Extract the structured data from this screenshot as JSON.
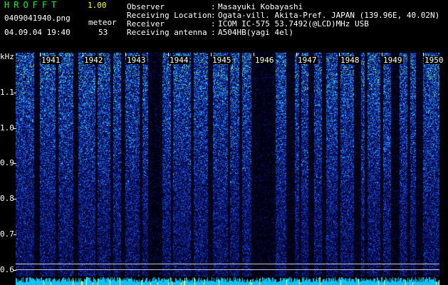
{
  "app": {
    "title": "HROFFT",
    "version": "1.00"
  },
  "capture": {
    "file_name": "0409041940.png",
    "datetime": "04.09.04 19:40",
    "meteor_label": "meteor",
    "meteor_count": "53"
  },
  "station": [
    {
      "label": "Observer",
      "value": "Masayuki Kobayashi"
    },
    {
      "label": "Receiving Location",
      "value": "Ogata-vill. Akita-Pref. JAPAN (139.96E, 40.02N)"
    },
    {
      "label": "Receiver",
      "value": "ICOM IC-575 53.7492(@LCD)MHz USB"
    },
    {
      "label": "Receiving antenna",
      "value": "A504HB(yagi 4el)"
    }
  ],
  "spectrogram": {
    "y_unit": "kHz",
    "y_ticks": [
      "1.1",
      "1.0",
      "0.9",
      "0.8",
      "0.7",
      "0.6"
    ],
    "y_range": [
      0.6,
      1.15
    ],
    "x_minutes": [
      "1941",
      "1942",
      "1943",
      "1944",
      "1945",
      "1946",
      "1947",
      "1948",
      "1949",
      "1950"
    ],
    "colors": {
      "background": "#000018",
      "noise_low": "#0a1a8c",
      "noise_mid": "#1e5adc",
      "noise_high": "#28c8ff",
      "hot": "#9aff40",
      "strip": "#00c8ff"
    }
  }
}
